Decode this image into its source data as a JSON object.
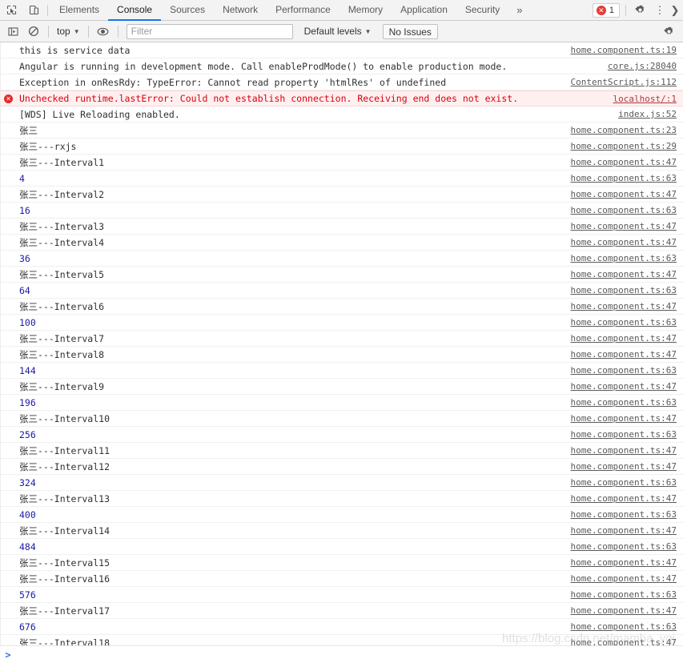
{
  "devtools": {
    "toolbar": {
      "inspect_icon": "inspect-element-icon",
      "device_icon": "device-toolbar-icon",
      "more_tabs_label": "»",
      "error_badge_count": "1",
      "error_badge_icon": "error-circle-icon",
      "settings_icon": "gear-icon",
      "menu_icon": "kebab-menu-icon",
      "close_icon": "chevron-right-icon"
    },
    "tabs": [
      {
        "label": "Elements",
        "active": false
      },
      {
        "label": "Console",
        "active": true
      },
      {
        "label": "Sources",
        "active": false
      },
      {
        "label": "Network",
        "active": false
      },
      {
        "label": "Performance",
        "active": false
      },
      {
        "label": "Memory",
        "active": false
      },
      {
        "label": "Application",
        "active": false
      },
      {
        "label": "Security",
        "active": false
      }
    ],
    "filterbar": {
      "sidebar_icon": "console-sidebar-icon",
      "clear_icon": "clear-console-icon",
      "context_label": "top",
      "eye_icon": "live-expression-icon",
      "filter_placeholder": "Filter",
      "filter_value": "",
      "levels_label": "Default levels",
      "issues_label": "No Issues",
      "settings_icon": "console-settings-icon"
    },
    "prompt": {
      "chevron": ">"
    },
    "watermark": "https://blog.csdn.net/mamba_yqj"
  },
  "colors": {
    "accent": "#1a73e8",
    "error_text": "#d8000c",
    "error_bg": "#fff0f0",
    "number": "#1a1aa6",
    "toolbar_bg": "#f3f3f3"
  },
  "console_rows": [
    {
      "text": "this is service data",
      "src": "home.component.ts:19",
      "type": "log"
    },
    {
      "text": "Angular is running in development mode. Call enableProdMode() to enable production mode.",
      "src": "core.js:28040",
      "type": "log"
    },
    {
      "text": "Exception in onResRdy: TypeError: Cannot read property 'htmlRes' of undefined",
      "src": "ContentScript.js:112",
      "type": "log"
    },
    {
      "text": "Unchecked runtime.lastError: Could not establish connection. Receiving end does not exist.",
      "src": "localhost/:1",
      "type": "error"
    },
    {
      "text": "[WDS] Live Reloading enabled.",
      "src": "index.js:52",
      "type": "log"
    },
    {
      "text": "张三",
      "src": "home.component.ts:23",
      "type": "log"
    },
    {
      "text": "张三---rxjs",
      "src": "home.component.ts:29",
      "type": "log"
    },
    {
      "text": "张三---Interval1",
      "src": "home.component.ts:47",
      "type": "log"
    },
    {
      "text": "4",
      "src": "home.component.ts:63",
      "type": "number"
    },
    {
      "text": "张三---Interval2",
      "src": "home.component.ts:47",
      "type": "log"
    },
    {
      "text": "16",
      "src": "home.component.ts:63",
      "type": "number"
    },
    {
      "text": "张三---Interval3",
      "src": "home.component.ts:47",
      "type": "log"
    },
    {
      "text": "张三---Interval4",
      "src": "home.component.ts:47",
      "type": "log"
    },
    {
      "text": "36",
      "src": "home.component.ts:63",
      "type": "number"
    },
    {
      "text": "张三---Interval5",
      "src": "home.component.ts:47",
      "type": "log"
    },
    {
      "text": "64",
      "src": "home.component.ts:63",
      "type": "number"
    },
    {
      "text": "张三---Interval6",
      "src": "home.component.ts:47",
      "type": "log"
    },
    {
      "text": "100",
      "src": "home.component.ts:63",
      "type": "number"
    },
    {
      "text": "张三---Interval7",
      "src": "home.component.ts:47",
      "type": "log"
    },
    {
      "text": "张三---Interval8",
      "src": "home.component.ts:47",
      "type": "log"
    },
    {
      "text": "144",
      "src": "home.component.ts:63",
      "type": "number"
    },
    {
      "text": "张三---Interval9",
      "src": "home.component.ts:47",
      "type": "log"
    },
    {
      "text": "196",
      "src": "home.component.ts:63",
      "type": "number"
    },
    {
      "text": "张三---Interval10",
      "src": "home.component.ts:47",
      "type": "log"
    },
    {
      "text": "256",
      "src": "home.component.ts:63",
      "type": "number"
    },
    {
      "text": "张三---Interval11",
      "src": "home.component.ts:47",
      "type": "log"
    },
    {
      "text": "张三---Interval12",
      "src": "home.component.ts:47",
      "type": "log"
    },
    {
      "text": "324",
      "src": "home.component.ts:63",
      "type": "number"
    },
    {
      "text": "张三---Interval13",
      "src": "home.component.ts:47",
      "type": "log"
    },
    {
      "text": "400",
      "src": "home.component.ts:63",
      "type": "number"
    },
    {
      "text": "张三---Interval14",
      "src": "home.component.ts:47",
      "type": "log"
    },
    {
      "text": "484",
      "src": "home.component.ts:63",
      "type": "number"
    },
    {
      "text": "张三---Interval15",
      "src": "home.component.ts:47",
      "type": "log"
    },
    {
      "text": "张三---Interval16",
      "src": "home.component.ts:47",
      "type": "log"
    },
    {
      "text": "576",
      "src": "home.component.ts:63",
      "type": "number"
    },
    {
      "text": "张三---Interval17",
      "src": "home.component.ts:47",
      "type": "log"
    },
    {
      "text": "676",
      "src": "home.component.ts:63",
      "type": "number"
    },
    {
      "text": "张三---Interval18",
      "src": "home.component.ts:47",
      "type": "log"
    }
  ]
}
